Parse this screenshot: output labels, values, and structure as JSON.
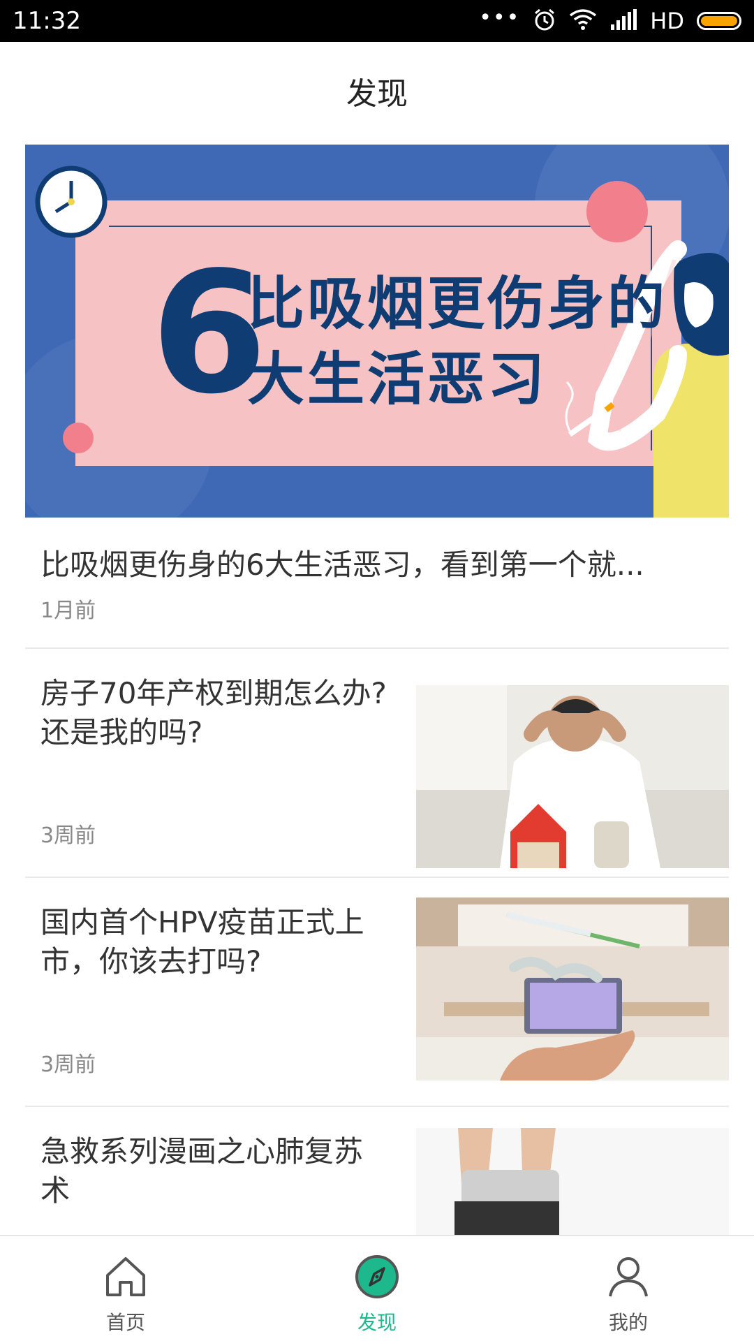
{
  "status_bar": {
    "time": "11:32",
    "dots": "•••",
    "network_label": "HD",
    "icons": [
      "alarm-icon",
      "wifi-icon",
      "signal-icon",
      "battery-icon"
    ],
    "battery_color": "#f8a300"
  },
  "header": {
    "title": "发现"
  },
  "banner": {
    "big_number": "6",
    "line1": "比吸烟更伤身的",
    "line2": "大生活恶习",
    "bg_color": "#3f69b5",
    "panel_color": "#f6c2c4",
    "text_color": "#0f3d73"
  },
  "articles": [
    {
      "title": "比吸烟更伤身的6大生活恶习，看到第一个就...",
      "time": "1月前"
    },
    {
      "title": "房子70年产权到期怎么办? 还是我的吗?",
      "time": "3周前"
    },
    {
      "title": "国内首个HPV疫苗正式上市，你该去打吗?",
      "time": "3周前"
    },
    {
      "title": "急救系列漫画之心肺复苏术",
      "time": ""
    }
  ],
  "bottom_nav": {
    "items": [
      {
        "label": "首页",
        "icon": "home-icon"
      },
      {
        "label": "发现",
        "icon": "compass-icon"
      },
      {
        "label": "我的",
        "icon": "user-icon"
      }
    ],
    "active_index": 1,
    "active_color": "#1db98d"
  }
}
